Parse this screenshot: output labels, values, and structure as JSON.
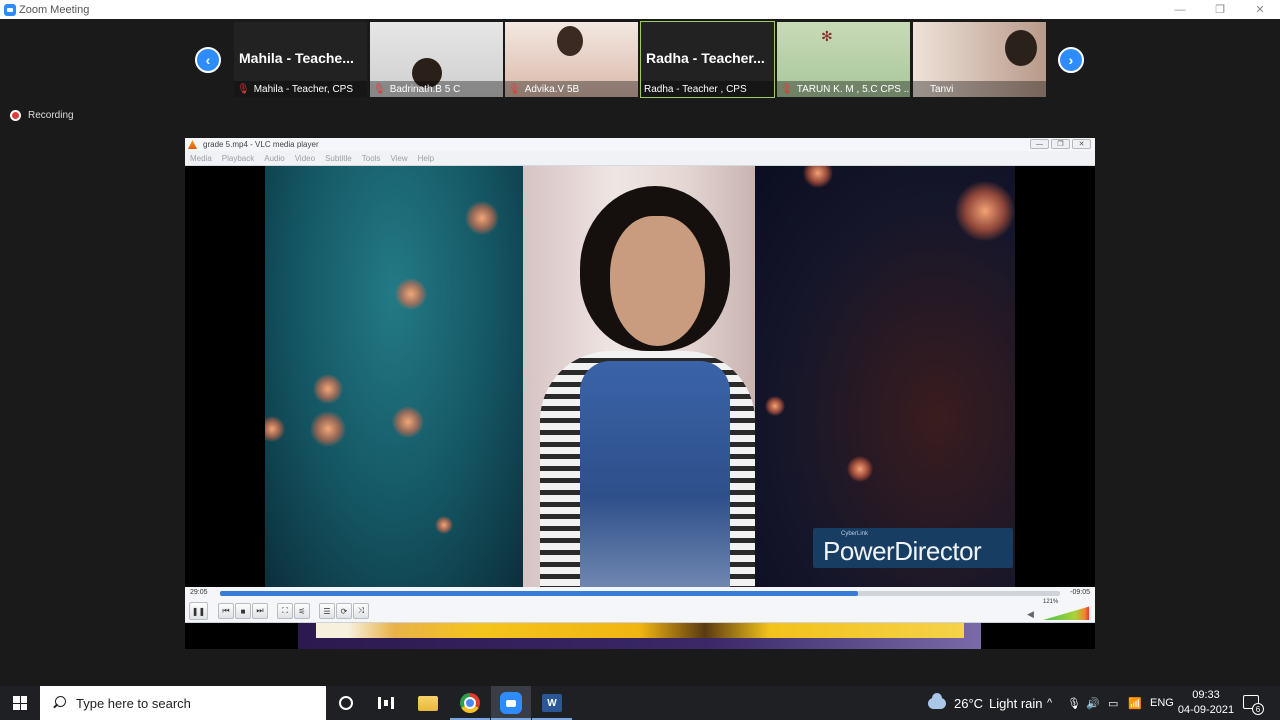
{
  "zoom": {
    "title": "Zoom Meeting",
    "window_controls": {
      "minimize": "—",
      "restore": "❐",
      "close": "✕"
    },
    "recording_label": "Recording",
    "nav": {
      "prev": "‹",
      "next": "›"
    },
    "participants": [
      {
        "display_name": "Mahila  - Teache...",
        "caption": "Mahila - Teacher, CPS",
        "muted": true
      },
      {
        "display_name": "",
        "caption": "Badrinath.B 5 C",
        "muted": true
      },
      {
        "display_name": "",
        "caption": "Advika.V 5B",
        "muted": true
      },
      {
        "display_name": "Radha  - Teacher...",
        "caption": "Radha - Teacher ,  CPS",
        "muted": false,
        "active_speaker": true
      },
      {
        "display_name": "",
        "caption": "TARUN K. M , 5.C CPS ...",
        "muted": true
      },
      {
        "display_name": "",
        "caption": "Tanvi",
        "muted": false
      }
    ]
  },
  "vlc": {
    "title": "grade 5.mp4 - VLC media player",
    "window_controls": {
      "minimize": "—",
      "restore": "❐",
      "close": "✕"
    },
    "menu": [
      "Media",
      "Playback",
      "Audio",
      "Video",
      "Subtitle",
      "Tools",
      "View",
      "Help"
    ],
    "elapsed": "29:05",
    "remaining": "-09:05",
    "progress": 0.76,
    "volume_label": "121%",
    "volume": 0.95,
    "overlay_small": "CyberLink",
    "overlay_brand": "PowerDirector",
    "controls": {
      "pause": "❚❚",
      "prev": "⏮",
      "stop": "■",
      "next": "⏭",
      "fullscreen": "⛶",
      "ext": "⚟",
      "playlist": "☰",
      "loop": "⟳",
      "shuffle": "⤨"
    }
  },
  "taskbar": {
    "search_placeholder": "Type here to search",
    "word_label": "W",
    "weather_temp": "26°C",
    "weather_text": "Light rain",
    "tray_chevron": "^",
    "tray_mic": "🎙",
    "tray_volume": "🔊",
    "tray_battery": "▭",
    "tray_wifi": "📶",
    "lang": "ENG",
    "time": "09:33",
    "date": "04-09-2021",
    "notification_count": "6"
  }
}
